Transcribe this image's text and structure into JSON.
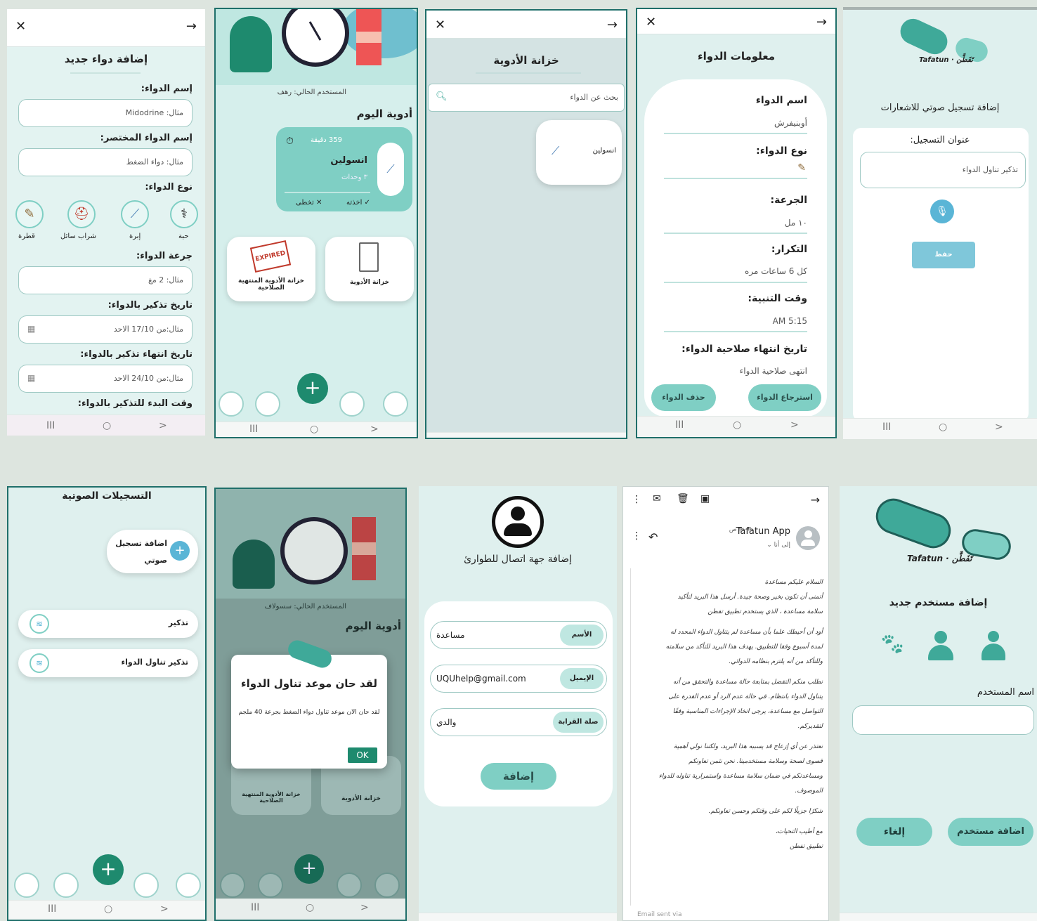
{
  "p1": {
    "title": "إضافة دواء جديد",
    "f1_label": "إسم الدواء:",
    "f1_ph": "مثال: Midodrine",
    "f2_label": "إسم الدواء المختصر:",
    "f2_ph": "مثال: دواء الضغط",
    "type_label": "نوع الدواء:",
    "types": [
      "حبة",
      "إبرة",
      "شراب سائل",
      "قطرة"
    ],
    "dose_label": "جرعة الدواء:",
    "dose_ph": "مثال: 2 مغ",
    "start_label": "تاريخ تذكير بالدواء:",
    "start_ph": "مثال:من 17/10 الاحد",
    "end_label": "تاريخ انتهاء تذكير بالدواء:",
    "end_ph": "مثال:من 24/10 الاحد",
    "time_label": "وقت البدء للتذكير بالدواء:",
    "nav": [
      "III",
      "○",
      ">"
    ]
  },
  "p2": {
    "user": "المستخدم الحالي: رهف",
    "today": "أدوية اليوم",
    "minutes": "359 دقيقة",
    "med": "انسولين",
    "units": "٣ وحدات",
    "taken": "✓ اخذته",
    "skip": "✕ تخطى",
    "card1": "خزانة الأدوية",
    "card2": "خزانة الأدوية المنتهية الصلاحية",
    "expired": "EXPIRED",
    "nav": [
      "III",
      "○",
      ">"
    ]
  },
  "p3": {
    "title": "خزانة الأدوية",
    "search_ph": "بحث عن الدواء",
    "med": "انسولين",
    "nav": [
      "III",
      "○",
      ">"
    ]
  },
  "p4": {
    "title": "معلومات الدواء",
    "name_label": "اسم الدواء",
    "name_val": "أوبنيفرش",
    "type_label": "نوع الدواء:",
    "dose_label": "الجرعة:",
    "dose_val": "١٠ مل",
    "freq_label": "التكرار:",
    "freq_val": "كل 6 ساعات مره",
    "time_label": "وقت التنبية:",
    "time_val": "AM 5:15",
    "exp_label": "تاريخ انتهاء صلاحية الدواء:",
    "exp_val": "انتهى صلاحية الدواء",
    "delete": "حذف الدواء",
    "restore": "استرجاع الدواء",
    "nav": [
      "III",
      "○",
      ">"
    ]
  },
  "p5": {
    "logo": "Tafatun · تَفَطَّن",
    "title": "إضافة تسجيل صوتي للاشعارات",
    "field_label": "عنوان التسجيل:",
    "field_val": "تذكير تناول الدواء",
    "save": "حفظ",
    "nav": [
      "III",
      "○",
      ">"
    ]
  },
  "p6": {
    "title": "التسجيلات الصوتية",
    "add": "اضافة تسجيل صوتي",
    "rec1": "تذكير",
    "rec2": "تذكير تناول الدواء",
    "nav": [
      "III",
      "○",
      ">"
    ]
  },
  "p7": {
    "user": "المستخدم الحالي: سسولاف",
    "today": "أدوية اليوم",
    "dialog_title": "لقد حان موعد تناول الدواء",
    "dialog_body": "لقد حان الان موعد تناول دواء الضغط بجرعة 40 ملجم",
    "ok": "OK",
    "card1": "خزانة الأدوية",
    "card2": "خزانة الأدوية المنتهية الصلاحية",
    "nav": [
      "III",
      "○",
      ">"
    ]
  },
  "p8": {
    "title": "إضافة جهة اتصال للطوارئ",
    "name_tag": "الأسم",
    "name_val": "مساعدة",
    "email_tag": "الإيميل",
    "email_val": "UQUhelp@gmail.com",
    "rel_tag": "صلة القرابة",
    "rel_val": "والدي",
    "add": "إضافة",
    "nav": [
      "III",
      "○",
      ">"
    ]
  },
  "p9": {
    "sender": "Tafatun App",
    "time": "٣:٠٣ ص",
    "to": "إلى أنا ⌄",
    "lines": [
      "السلام عليكم مساعدة",
      "أتمنى أن تكون بخير وصحة جيدة. أرسل هذا البريد لتأكيد",
      "سلامة مساعدة ، الذي يستخدم تطبيق تفطن",
      "أود أن أحيطك علما بأن مساعدة لم يتناول الدواء المحدد له",
      "لمدة أسبوع وفقا للتطبيق. يهدف هذا البريد للتأكد من سلامته",
      "وللتأكد من أنه يلتزم بنظامه الدوائي.",
      "نطلب منكم التفضل بمتابعة حالة مساعدة والتحقق من أنه",
      "يتناول الدواء بانتظام. في حالة عدم الرد أو عدم القدرة على",
      "التواصل مع مساعدة، يرجى اتخاذ الإجراءات المناسبة وفقًا",
      "لتقديركم.",
      "نعتذر عن أي إزعاج قد يسببه هذا البريد، ولكننا نولي أهمية",
      "قصوى لصحة وسلامة مستخدمينا. نحن نثمن تعاونكم",
      "ومساعدتكم في ضمان سلامة مساعدة واستمرارية تناوله للدواء",
      "الموصوف.",
      "شكرًا جزيلًا لكم على وقتكم وحسن تعاونكم.",
      "مع أطيب التحيات،",
      "تطبيق تفطن"
    ],
    "footer": "Email sent via",
    "nav": [
      "III",
      "○",
      ">"
    ]
  },
  "p10": {
    "logo": "Tafatun · تَفَطَّن",
    "title": "إضافة مستخدم جديد",
    "field_label": "اسم المستخدم",
    "cancel": "إلغاء",
    "add": "اضافة مستخدم",
    "nav": [
      "III",
      "○",
      ">"
    ]
  },
  "colors": {
    "primary": "#3fa999",
    "teal_light": "#7fcfc4",
    "bg": "#dff0ee",
    "accent_blue": "#5ab5d6",
    "green_fab": "#1e8a6e"
  }
}
